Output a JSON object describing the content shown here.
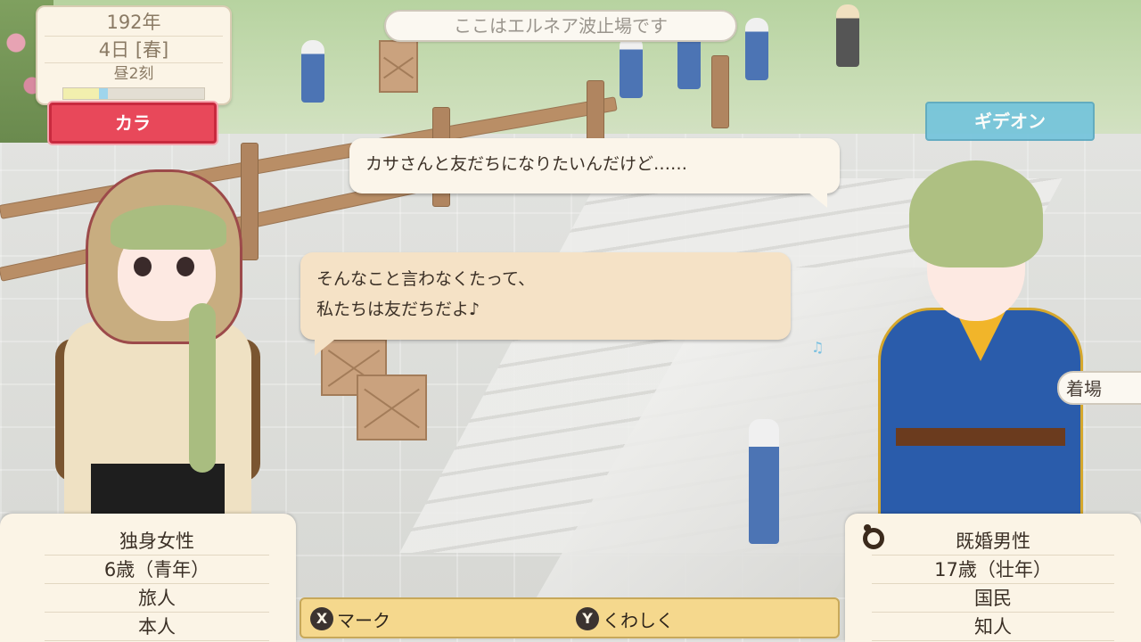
{
  "calendar": {
    "year": "192年",
    "day_season": "4日 [春]",
    "time_of_day": "昼2刻",
    "time_progress": 0.25
  },
  "location_banner": "ここはエルネア波止場です",
  "speakers": {
    "left_name": "カラ",
    "right_name": "ギデオン"
  },
  "dialogue": {
    "line_1": "カサさんと友だちになりたいんだけど……",
    "line_2a": "そんなこと言わなくたって、",
    "line_2b": "私たちは友だちだよ♪"
  },
  "left_profile": {
    "status": "独身女性",
    "age": "6歳（青年）",
    "occupation": "旅人",
    "relation": "本人"
  },
  "right_profile": {
    "status": "既婚男性",
    "age": "17歳（壮年）",
    "occupation": "国民",
    "relation": "知人",
    "icon": "wedding-ring-icon"
  },
  "controls": {
    "x_button": "X",
    "x_label": "マーク",
    "y_button": "Y",
    "y_label": "くわしく"
  },
  "side_tag": "着場",
  "colors": {
    "left_nameplate": "#e8485a",
    "right_nameplate": "#74c4dc",
    "control_bar": "#f5d88d"
  }
}
